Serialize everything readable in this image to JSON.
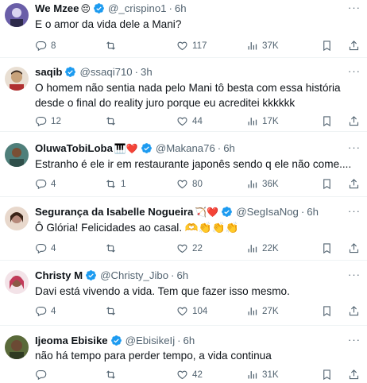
{
  "tweets": [
    {
      "name": "We Mzee",
      "emoji": "😔",
      "handle": "@_crispino1",
      "separator": "·",
      "time": "6h",
      "text": "E o amor da vida dele a Mani?",
      "replies": "8",
      "retweets": "",
      "likes": "117",
      "views": "37K",
      "avatar_color": "#6a5ea8"
    },
    {
      "name": "saqib",
      "emoji": "",
      "handle": "@ssaqi710",
      "separator": "·",
      "time": "3h",
      "text": "O homem não sentia nada pelo Mani tô besta com essa história desde o final do reality juro porque eu acreditei kkkkkk",
      "replies": "12",
      "retweets": "",
      "likes": "44",
      "views": "17K",
      "avatar_color": "#c8a27a"
    },
    {
      "name": "OluwaTobiLoba",
      "emoji": "🎹❤️",
      "handle": "@Makana76",
      "separator": "·",
      "time": "6h",
      "text": "Estranho é ele ir em restaurante japonês sendo q ele não come....",
      "replies": "4",
      "retweets": "1",
      "likes": "80",
      "views": "36K",
      "avatar_color": "#4f7f7a"
    },
    {
      "name": "Segurança da Isabelle Nogueira",
      "emoji": "🏹❤️",
      "handle": "@SegIsaNog",
      "separator": "·",
      "time": "6h",
      "text": "Ô Glória! Felicidades ao casal. 🫶👏👏👏",
      "replies": "4",
      "retweets": "",
      "likes": "22",
      "views": "22K",
      "avatar_color": "#b5887a"
    },
    {
      "name": "Christy M",
      "emoji": "",
      "handle": "@Christy_Jibo",
      "separator": "·",
      "time": "6h",
      "text": "Davi está vivendo a vida. Tem que fazer isso mesmo.",
      "replies": "4",
      "retweets": "",
      "likes": "104",
      "views": "27K",
      "avatar_color": "#c23a5a"
    },
    {
      "name": "Ijeoma Ebisike",
      "emoji": "",
      "handle": "@EbisikeIj",
      "separator": "·",
      "time": "6h",
      "text": "não há tempo para perder tempo, a vida continua",
      "replies": "",
      "retweets": "",
      "likes": "42",
      "views": "31K",
      "avatar_color": "#5a6a3a"
    }
  ],
  "colors": {
    "verified": "#1d9bf0",
    "muted": "#536471",
    "text": "#0f1419",
    "divider": "#eff3f4"
  }
}
